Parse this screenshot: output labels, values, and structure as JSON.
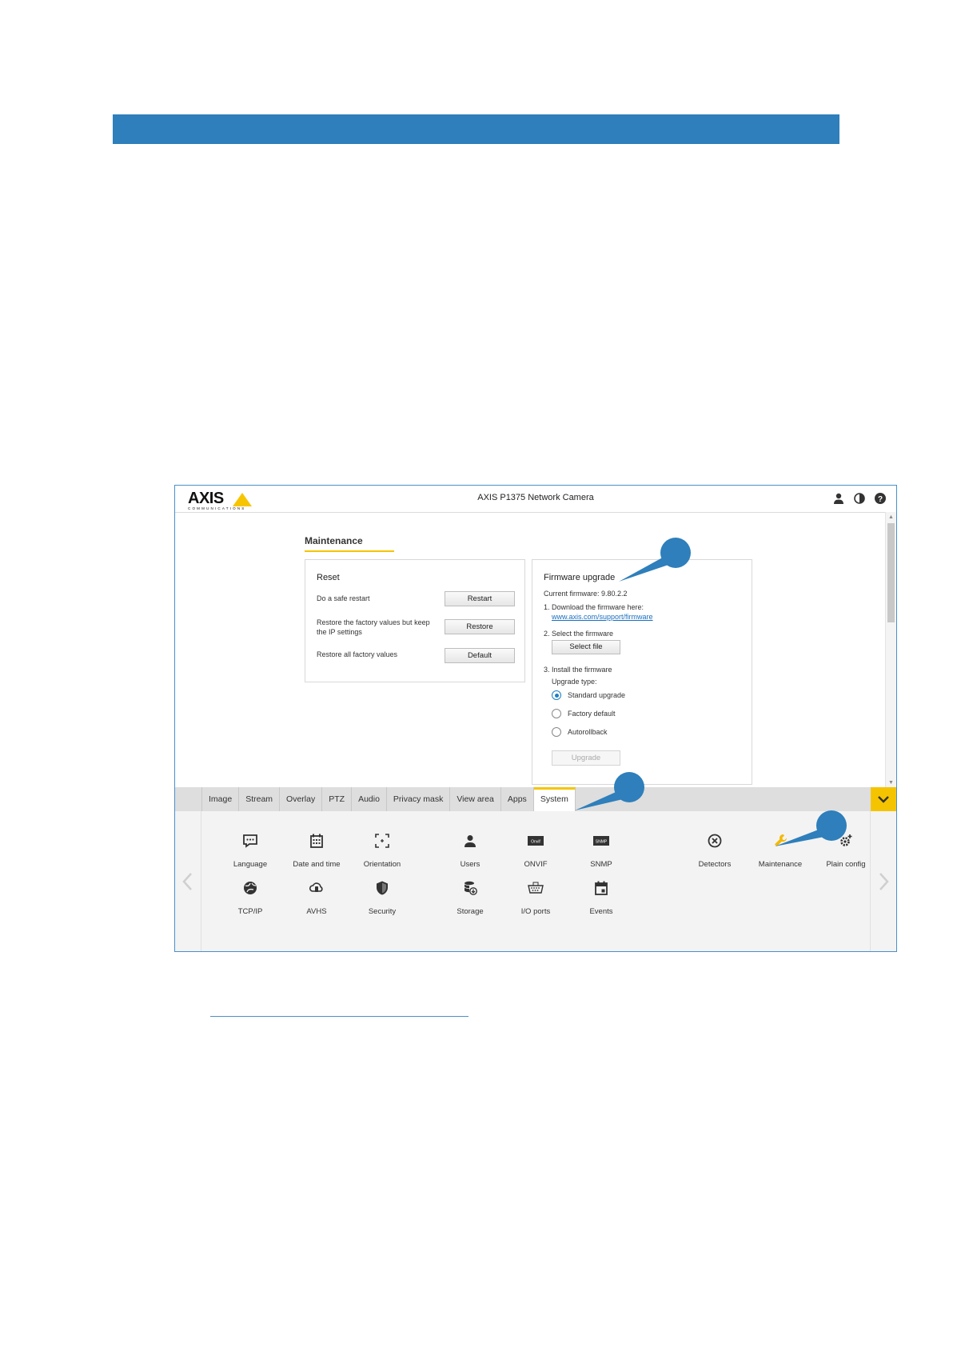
{
  "app": {
    "logo_word": "AXIS",
    "logo_sub": "COMMUNICATIONS",
    "title": "AXIS P1375 Network Camera"
  },
  "topbar_icons": [
    "user-icon",
    "contrast-icon",
    "help-icon"
  ],
  "maintenance": {
    "title": "Maintenance",
    "reset": {
      "title": "Reset",
      "rows": [
        {
          "text": "Do a safe restart",
          "button": "Restart"
        },
        {
          "text": "Restore the factory values but keep the IP settings",
          "button": "Restore"
        },
        {
          "text": "Restore all factory values",
          "button": "Default"
        }
      ]
    },
    "firmware": {
      "title": "Firmware upgrade",
      "current": "Current firmware: 9.80.2.2",
      "step1": "1. Download the firmware here:",
      "link": "www.axis.com/support/firmware",
      "step2": "2. Select the firmware",
      "select_button": "Select file",
      "step3": "3. Install the firmware",
      "upgrade_type_label": "Upgrade type:",
      "options": [
        "Standard upgrade",
        "Factory default",
        "Autorollback"
      ],
      "selected_option": "Standard upgrade",
      "upgrade_button": "Upgrade"
    }
  },
  "tabs": [
    "Image",
    "Stream",
    "Overlay",
    "PTZ",
    "Audio",
    "Privacy mask",
    "View area",
    "Apps",
    "System"
  ],
  "active_tab": "System",
  "system_items": [
    {
      "label": "Language",
      "icon": "language-icon"
    },
    {
      "label": "Date and time",
      "icon": "calendar-icon"
    },
    {
      "label": "Orientation",
      "icon": "orientation-icon"
    },
    {
      "label": "Users",
      "icon": "users-icon"
    },
    {
      "label": "ONVIF",
      "icon": "onvif-icon",
      "icon_text": "Onvif"
    },
    {
      "label": "SNMP",
      "icon": "snmp-icon",
      "icon_text": "SNMP"
    },
    {
      "label": "Detectors",
      "icon": "detectors-icon"
    },
    {
      "label": "Maintenance",
      "icon": "wrench-icon"
    },
    {
      "label": "Plain config",
      "icon": "plain-config-icon"
    },
    {
      "label": "TCP/IP",
      "icon": "network-icon"
    },
    {
      "label": "AVHS",
      "icon": "cloud-icon"
    },
    {
      "label": "Security",
      "icon": "shield-icon"
    },
    {
      "label": "Storage",
      "icon": "storage-icon"
    },
    {
      "label": "I/O ports",
      "icon": "io-ports-icon"
    },
    {
      "label": "Events",
      "icon": "events-icon"
    }
  ],
  "selected_system_item": "Maintenance",
  "colors": {
    "band": "#2e7fbb",
    "accent_yellow": "#f5c400",
    "callout": "#2e7fbb",
    "link": "#1a6fc0",
    "radio": "#1e7fc4"
  }
}
